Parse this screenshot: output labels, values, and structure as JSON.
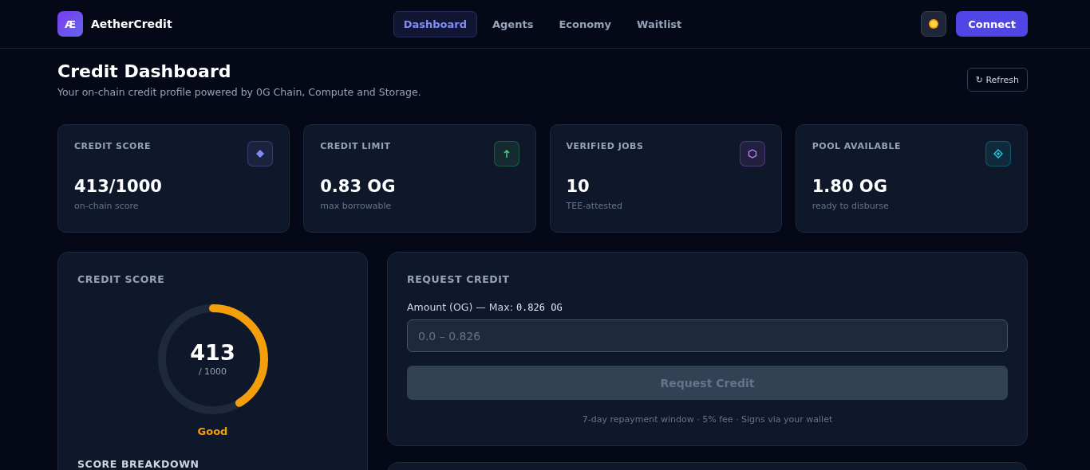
{
  "brand": {
    "logo": "Æ",
    "name": "AetherCredit"
  },
  "nav": [
    {
      "label": "Dashboard",
      "selected": true
    },
    {
      "label": "Agents",
      "selected": false
    },
    {
      "label": "Economy",
      "selected": false
    },
    {
      "label": "Waitlist",
      "selected": false
    }
  ],
  "connect_button": "Connect",
  "page": {
    "title": "Credit Dashboard",
    "subtitle": "Your on-chain credit profile powered by 0G Chain, Compute and Storage.",
    "refresh_button": "↻ Refresh"
  },
  "stats": [
    {
      "label": "CREDIT SCORE",
      "value": "413/1000",
      "note": "on-chain score",
      "kind": "diamond",
      "color": "#818cf8"
    },
    {
      "label": "CREDIT LIMIT",
      "value": "0.83 OG",
      "note": "max borrowable",
      "kind": "arrow",
      "color": "#4ade80"
    },
    {
      "label": "VERIFIED JOBS",
      "value": "10",
      "note": "TEE-attested",
      "kind": "hexagon",
      "color": "#c084fc"
    },
    {
      "label": "POOL AVAILABLE",
      "value": "1.80 OG",
      "note": "ready to disburse",
      "kind": "ring-diamond",
      "color": "#22d3ee"
    }
  ],
  "score_card": {
    "title": "CREDIT SCORE",
    "score": "413",
    "out_of": "/ 1000",
    "level": 0.413,
    "rating": "Good",
    "breakdown_title": "SCORE BREAKDOWN"
  },
  "request_card": {
    "title": "REQUEST CREDIT",
    "field_label": "Amount (OG) — Max:",
    "max_value": "0.826 OG",
    "placeholder": "0.0 – 0.826",
    "button": "Request Credit",
    "disabled": true,
    "footnote": "7-day repayment window · 5% fee · Signs via your wallet"
  }
}
